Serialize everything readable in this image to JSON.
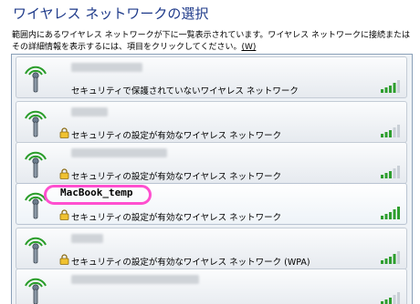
{
  "page": {
    "title": "ワイヤレス ネットワークの選択",
    "description": "範囲内にあるワイヤレス ネットワークが下に一覧表示されています。ワイヤレス ネットワークに接続またはその詳細情報を表示するには、項目をクリックしてください。",
    "accelerator": "(W)"
  },
  "networks": [
    {
      "name": "xxxxxxxxxx",
      "name_visible": false,
      "security": "セキュリティで保護されていないワイヤレス ネットワーク",
      "locked": false,
      "signal_bars": 4
    },
    {
      "name": "xxxxxx",
      "name_visible": false,
      "security": "セキュリティの設定が有効なワイヤレス ネットワーク",
      "locked": true,
      "signal_bars": 3
    },
    {
      "name": "xxxxxxxxxxxxxx",
      "name_visible": false,
      "security": "セキュリティの設定が有効なワイヤレス ネットワーク",
      "locked": true,
      "signal_bars": 3
    },
    {
      "name": "MacBook_temp",
      "name_visible": true,
      "security": "セキュリティの設定が有効なワイヤレス ネットワーク",
      "locked": true,
      "signal_bars": 5
    },
    {
      "name": "xxxxx",
      "name_visible": false,
      "security": "セキュリティの設定が有効なワイヤレス ネットワーク (WPA)",
      "locked": true,
      "signal_bars": 4
    },
    {
      "name": "xxxxxxxxxxxxxxxxxxx",
      "name_visible": false,
      "security": "",
      "locked": false,
      "signal_bars": 3
    }
  ],
  "colors": {
    "title": "#1e3a8a",
    "highlight": "#ff4fcf",
    "signal_on": "#2e9e2e",
    "signal_off": "#c9cfd6"
  }
}
